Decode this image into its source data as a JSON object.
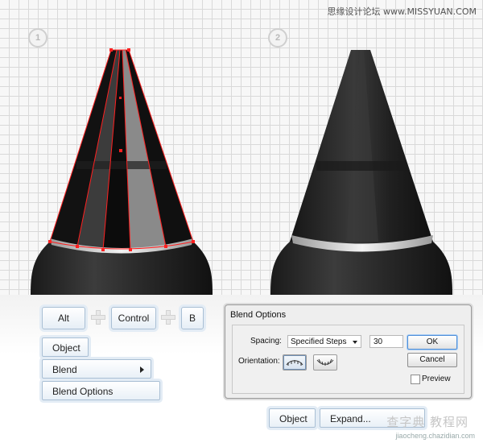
{
  "watermark_top": "思缘设计论坛 www.MISSYUAN.COM",
  "steps": [
    {
      "number": "1"
    },
    {
      "number": "2"
    }
  ],
  "shortcut": {
    "keys": [
      "Alt",
      "Control",
      "B"
    ]
  },
  "menu_path": {
    "object": "Object",
    "blend": "Blend",
    "blend_options": "Blend Options"
  },
  "dialog": {
    "title": "Blend Options",
    "spacing_label": "Spacing:",
    "spacing_value": "Specified Steps",
    "steps_value": "30",
    "orientation_label": "Orientation:",
    "ok_label": "OK",
    "cancel_label": "Cancel",
    "preview_label": "Preview",
    "preview_checked": false
  },
  "expand_path": {
    "object": "Object",
    "expand": "Expand..."
  },
  "watermark_bottom": {
    "logo": "查字典 教程网",
    "url": "jiaocheng.chazidian.com"
  },
  "colors": {
    "grid_line": "#d9d9d9",
    "path_red": "#ff2020",
    "key_border": "#a9bfd4",
    "ok_border": "#4f8fd8"
  }
}
